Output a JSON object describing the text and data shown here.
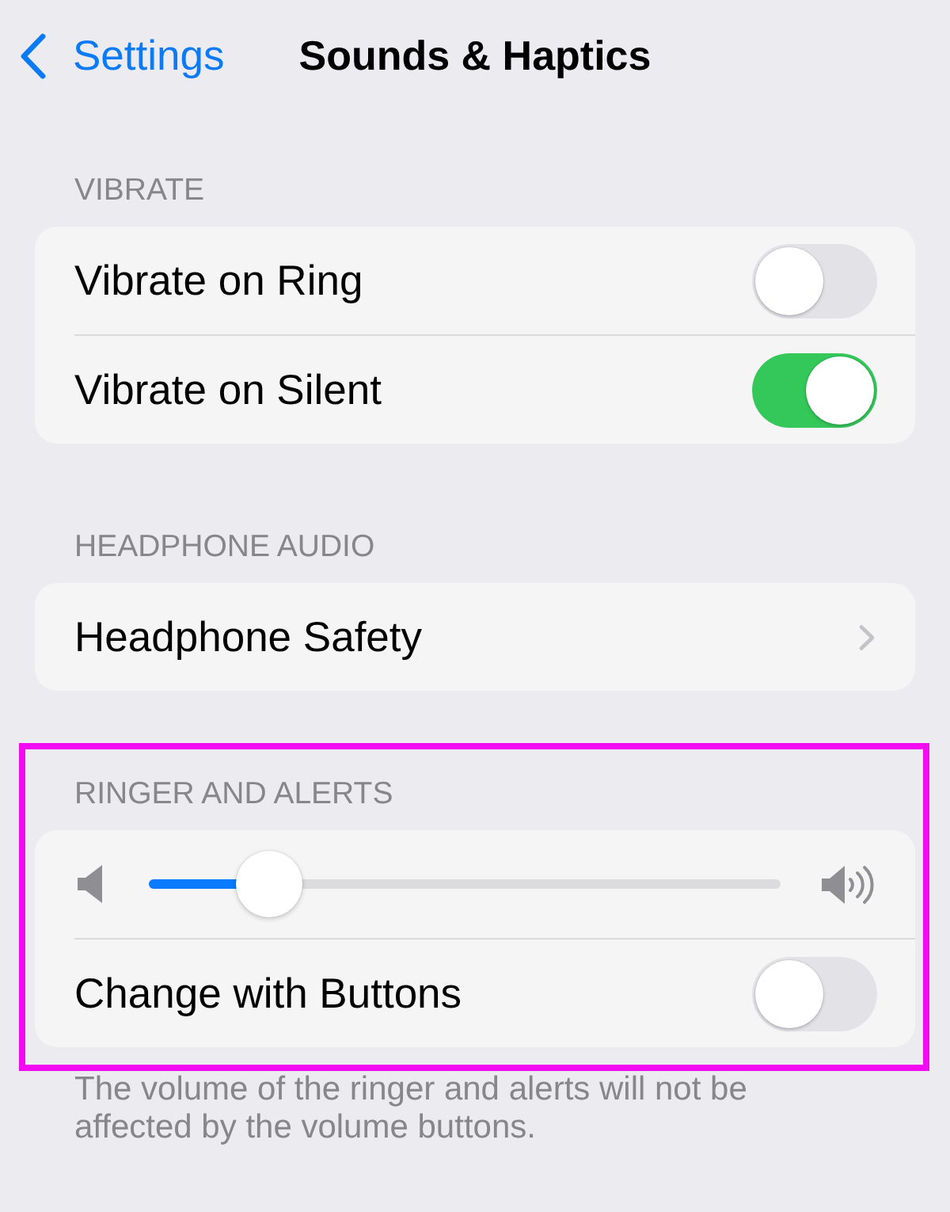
{
  "nav": {
    "back_label": "Settings",
    "title": "Sounds & Haptics"
  },
  "sections": [
    {
      "header": "VIBRATE",
      "highlighted": false,
      "rows": [
        {
          "kind": "toggle",
          "label": "Vibrate on Ring",
          "on": false
        },
        {
          "kind": "toggle",
          "label": "Vibrate on Silent",
          "on": true
        }
      ]
    },
    {
      "header": "HEADPHONE AUDIO",
      "highlighted": false,
      "rows": [
        {
          "kind": "link",
          "label": "Headphone Safety"
        }
      ]
    },
    {
      "header": "RINGER AND ALERTS",
      "highlighted": true,
      "rows": [
        {
          "kind": "slider",
          "level": 0.19
        },
        {
          "kind": "toggle",
          "label": "Change with Buttons",
          "on": false
        }
      ],
      "footer": "The volume of the ringer and alerts will not be affected by the volume buttons."
    }
  ]
}
